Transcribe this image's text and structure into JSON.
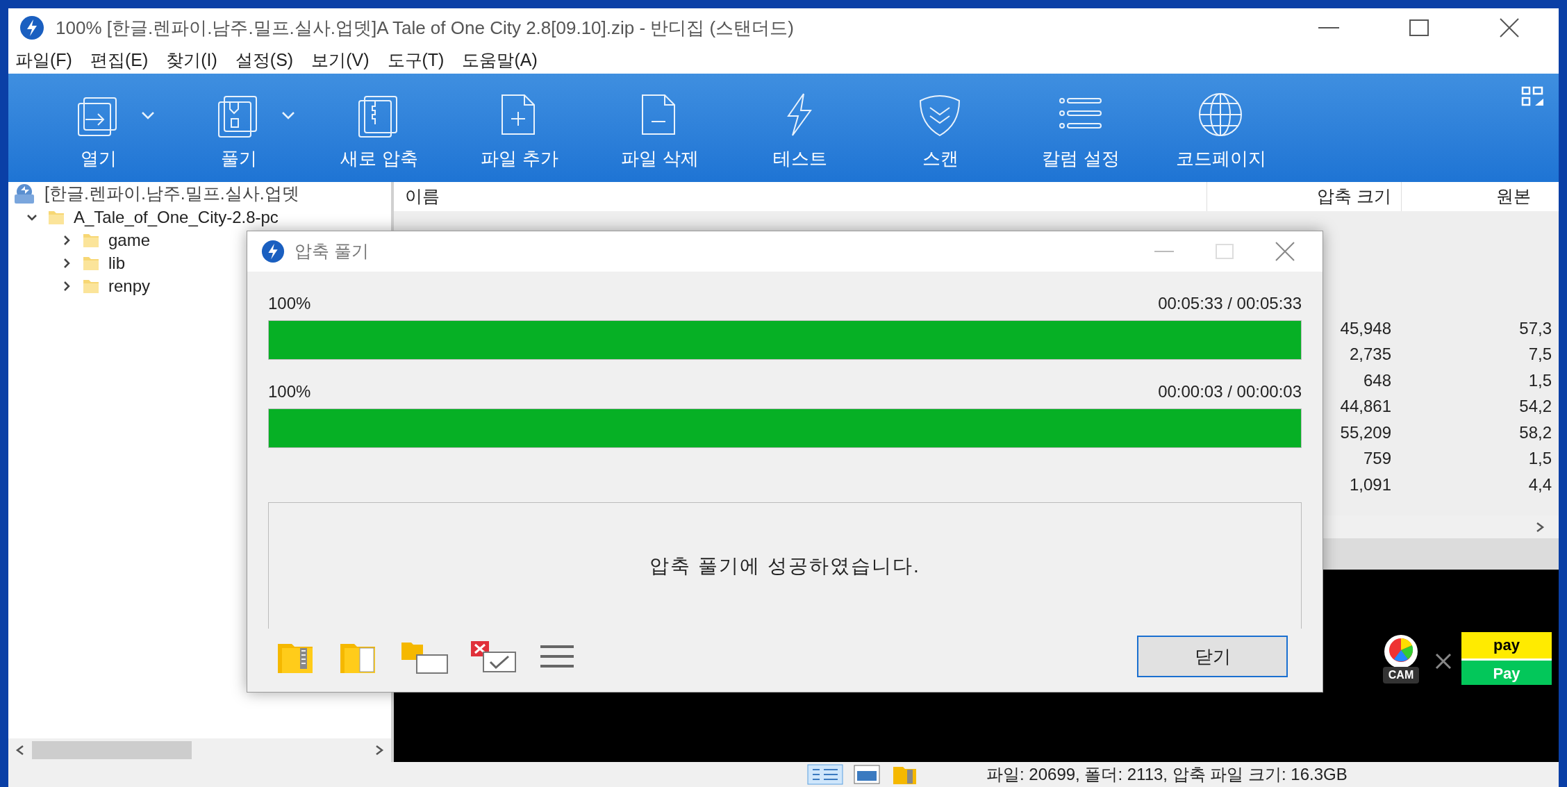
{
  "window": {
    "title": "100% [한글.렌파이.남주.밀프.실사.업뎃]A Tale of One City 2.8[09.10].zip - 반디집 (스탠더드)"
  },
  "menu": [
    "파일(F)",
    "편집(E)",
    "찾기(I)",
    "설정(S)",
    "보기(V)",
    "도구(T)",
    "도움말(A)"
  ],
  "toolbar": [
    {
      "kind": "open",
      "label": "열기",
      "dropdown": true
    },
    {
      "kind": "extract",
      "label": "풀기",
      "dropdown": true
    },
    {
      "kind": "new",
      "label": "새로 압축",
      "dropdown": false
    },
    {
      "kind": "add",
      "label": "파일 추가",
      "dropdown": false
    },
    {
      "kind": "delete",
      "label": "파일 삭제",
      "dropdown": false
    },
    {
      "kind": "test",
      "label": "테스트",
      "dropdown": false
    },
    {
      "kind": "scan",
      "label": "스캔",
      "dropdown": false
    },
    {
      "kind": "columns",
      "label": "칼럼 설정",
      "dropdown": false
    },
    {
      "kind": "codepage",
      "label": "코드페이지",
      "dropdown": false
    }
  ],
  "tree": {
    "root": "[한글.렌파이.남주.밀프.실사.업뎃",
    "items": [
      {
        "name": "A_Tale_of_One_City-2.8-pc",
        "expanded": true,
        "children": [
          {
            "name": "game",
            "expanded": false
          },
          {
            "name": "lib",
            "expanded": false
          },
          {
            "name": "renpy",
            "expanded": false
          }
        ]
      }
    ]
  },
  "file_list": {
    "columns": [
      "이름",
      "압축 크기",
      "원본"
    ],
    "rows": [
      {
        "compressed": "45,948",
        "original": "57,3"
      },
      {
        "compressed": "2,735",
        "original": "7,5"
      },
      {
        "compressed": "648",
        "original": "1,5"
      },
      {
        "compressed": "44,861",
        "original": "54,2"
      },
      {
        "compressed": "55,209",
        "original": "58,2"
      },
      {
        "compressed": "759",
        "original": "1,5"
      },
      {
        "compressed": "1,091",
        "original": "4,4"
      }
    ]
  },
  "dialog": {
    "title": "압축 풀기",
    "progress": [
      {
        "percent": "100%",
        "time": "00:05:33 / 00:05:33",
        "level": 1
      },
      {
        "percent": "100%",
        "time": "00:00:03 / 00:00:03",
        "level": 1
      }
    ],
    "message": "압축 풀기에 성공하였습니다.",
    "close_button": "닫기"
  },
  "ad": {
    "cam": "CAM",
    "pay_top": "pay",
    "pay_bottom": "Pay"
  },
  "status_bar": {
    "text": "파일: 20699, 폴더: 2113, 압축 파일 크기: 16.3GB"
  }
}
